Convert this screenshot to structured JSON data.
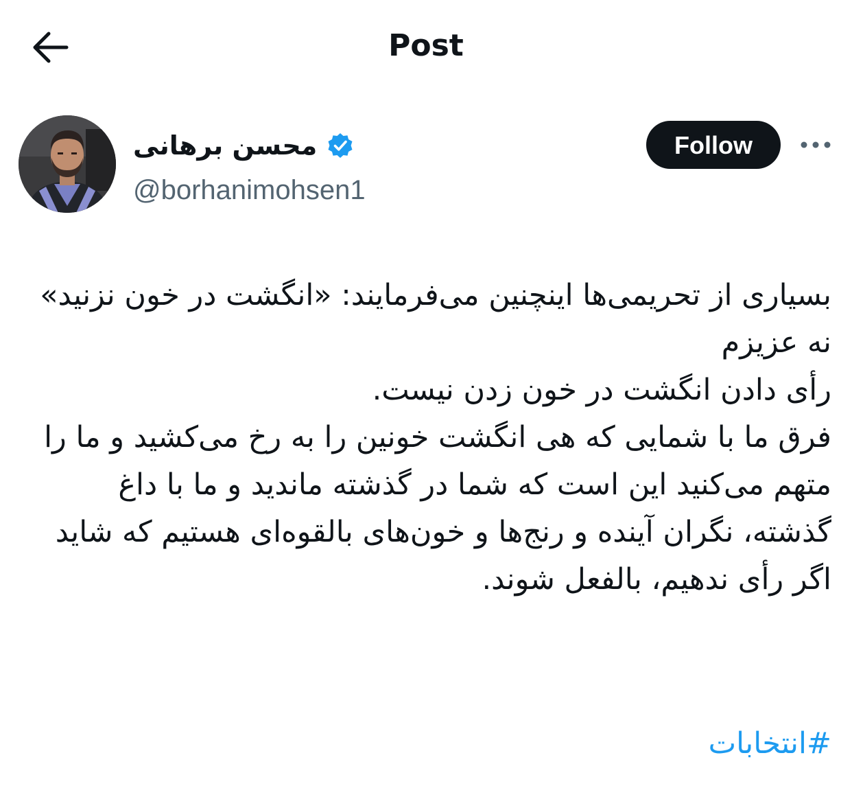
{
  "header": {
    "title": "Post",
    "back_icon": "arrow-left-icon"
  },
  "author": {
    "display_name": "محسن برهانی",
    "handle": "@borhanimohsen1",
    "verified_icon": "verified-badge-icon",
    "verified_color": "#1d9bf0",
    "follow_label": "Follow",
    "more_icon": "more-dots-icon"
  },
  "post": {
    "lines": [
      "بسیاری از تحریمی‌ها اینچنین می‌فرمایند: «انگشت در خون نزنید»",
      "نه عزیزم",
      "رأی دادن انگشت در خون زدن نیست.",
      "فرق ما با شمایی که هی انگشت خونین را به رخ می‌کشید و ما را متهم می‌کنید این است که شما در گذشته ماندید و ما با داغ گذشته، نگران آینده و رنج‌ها و خون‌های بالقوه‌ای هستیم که شاید اگر رأی ندهیم، بالفعل شوند."
    ],
    "hashtag": "#انتخابات",
    "hashtag_color": "#1d9bf0"
  }
}
